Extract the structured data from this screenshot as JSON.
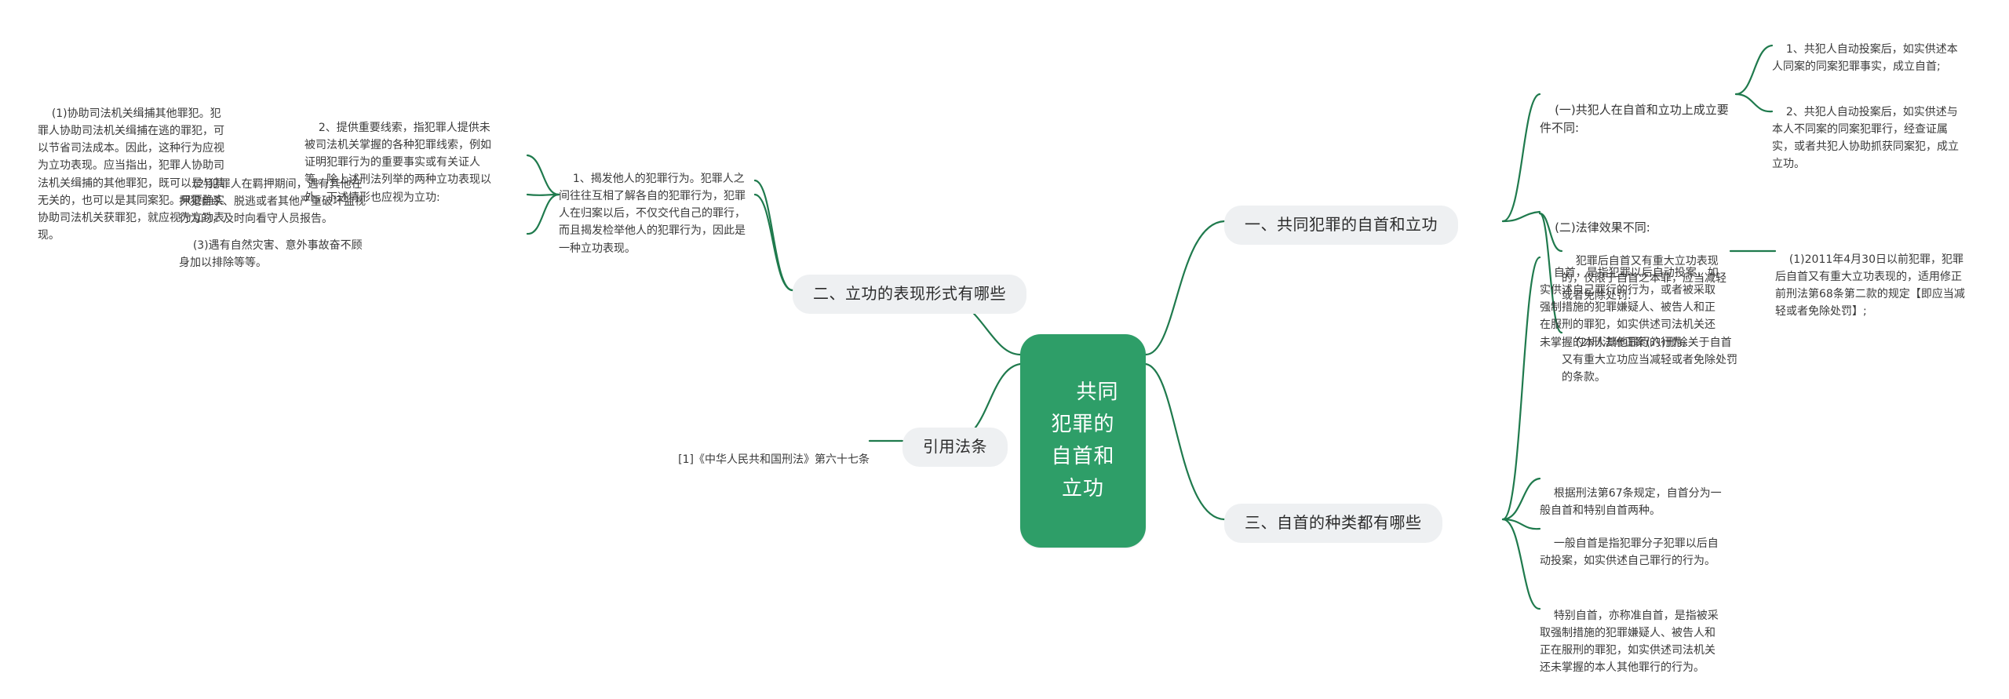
{
  "theme": {
    "root_fill": "#2e9e68",
    "root_text": "#ffffff",
    "pill_fill": "#eef0f2",
    "pill_text": "#2b2b2b",
    "link_color": "#1f7a4d",
    "body_text": "#333333",
    "background": "#ffffff"
  },
  "root": {
    "label": "共同犯罪的自首和立功"
  },
  "branches": {
    "b1": {
      "label": "一、共同犯罪的自首和立功",
      "c1": {
        "label": "(一)共犯人在自首和立功上成立要件不同:",
        "d1": "1、共犯人自动投案后，如实供述本人同案的同案犯罪事实，成立自首;",
        "d2": "2、共犯人自动投案后，如实供述与本人不同案的同案犯罪行，经查证属实，或者共犯人协助抓获同案犯，成立立功。"
      },
      "c2": {
        "label": "(二)法律效果不同:",
        "d1": "犯罪后自首又有重大立功表现的，仅限于自首之本罪，应当减轻或者免除处罚:",
        "d1x": "(1)2011年4月30日以前犯罪，犯罪后自首又有重大立功表现的，适用修正前刑法第68条第二款的规定【即应当减轻或者免除处罚】;",
        "d2": "(2)刑法修正案(八)删除关于自首又有重大立功应当减轻或者免除处罚的条款。"
      }
    },
    "b2": {
      "label": "二、立功的表现形式有哪些",
      "c1": "1、揭发他人的犯罪行为。犯罪人之间往往互相了解各自的犯罪行为，犯罪人在归案以后，不仅交代自己的罪行，而且揭发检举他人的犯罪行为，因此是一种立功表现。",
      "c2": {
        "label": "2、提供重要线索，指犯罪人提供未被司法机关掌握的各种犯罪线索，例如证明犯罪行为的重要事实或有关证人等。除上述刑法列举的两种立功表现以外，下述情形也应视为立功:",
        "d1": "(1)协助司法机关缉捕其他罪犯。犯罪人协助司法机关缉捕在逃的罪犯，可以节省司法成本。因此，这种行为应视为立功表现。应当指出，犯罪人协助司法机关缉捕的其他罪犯，既可以是与其无关的，也可以是其同案犯。只要确实协助司法机关获罪犯，就应视为立功表现。",
        "d2": "(2)犯罪人在羁押期间，遇有其他在押犯自杀、脱逃或者其他严重破坏监视行为的，及时向看守人员报告。",
        "d3": "(3)遇有自然灾害、意外事故奋不顾身加以排除等等。"
      }
    },
    "b3": {
      "label": "引用法条",
      "c1": "[1]《中华人民共和国刑法》第六十七条"
    },
    "b4": {
      "label": "三、自首的种类都有哪些",
      "c1": "自首，是指犯罪以后自动投案，如实供述自己罪行的行为，或者被采取强制措施的犯罪嫌疑人、被告人和正在服刑的罪犯，如实供述司法机关还未掌握的本人其他罪行的行为。",
      "c2": "根据刑法第67条规定，自首分为一般自首和特别自首两种。",
      "c3": "一般自首是指犯罪分子犯罪以后自动投案，如实供述自己罪行的行为。",
      "c4": "特别自首，亦称准自首，是指被采取强制措施的犯罪嫌疑人、被告人和正在服刑的罪犯，如实供述司法机关还未掌握的本人其他罪行的行为。"
    }
  }
}
